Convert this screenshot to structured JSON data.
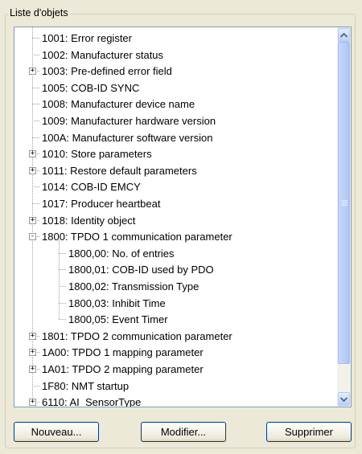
{
  "group_title": "Liste d'objets",
  "tree_items": [
    {
      "label": "1001: Error register",
      "level": 0,
      "expander": ""
    },
    {
      "label": "1002: Manufacturer status",
      "level": 0,
      "expander": ""
    },
    {
      "label": "1003: Pre-defined error field",
      "level": 0,
      "expander": "+"
    },
    {
      "label": "1005: COB-ID SYNC",
      "level": 0,
      "expander": ""
    },
    {
      "label": "1008: Manufacturer device name",
      "level": 0,
      "expander": ""
    },
    {
      "label": "1009: Manufacturer hardware version",
      "level": 0,
      "expander": ""
    },
    {
      "label": "100A: Manufacturer software version",
      "level": 0,
      "expander": ""
    },
    {
      "label": "1010: Store parameters",
      "level": 0,
      "expander": "+"
    },
    {
      "label": "1011: Restore default parameters",
      "level": 0,
      "expander": "+"
    },
    {
      "label": "1014: COB-ID EMCY",
      "level": 0,
      "expander": ""
    },
    {
      "label": "1017: Producer heartbeat",
      "level": 0,
      "expander": ""
    },
    {
      "label": "1018: Identity object",
      "level": 0,
      "expander": "+"
    },
    {
      "label": "1800: TPDO 1 communication parameter",
      "level": 0,
      "expander": "-"
    },
    {
      "label": "1800,00: No. of entries",
      "level": 1,
      "expander": ""
    },
    {
      "label": "1800,01: COB-ID used by PDO",
      "level": 1,
      "expander": ""
    },
    {
      "label": "1800,02: Transmission Type",
      "level": 1,
      "expander": ""
    },
    {
      "label": "1800,03: Inhibit Time",
      "level": 1,
      "expander": ""
    },
    {
      "label": "1800,05: Event Timer",
      "level": 1,
      "expander": ""
    },
    {
      "label": "1801: TPDO 2 communication parameter",
      "level": 0,
      "expander": "+"
    },
    {
      "label": "1A00: TPDO 1 mapping parameter",
      "level": 0,
      "expander": "+"
    },
    {
      "label": "1A01: TPDO 2 mapping parameter",
      "level": 0,
      "expander": "+"
    },
    {
      "label": "1F80: NMT startup",
      "level": 0,
      "expander": ""
    },
    {
      "label": "6110: AI_SensorType",
      "level": 0,
      "expander": "+"
    }
  ],
  "scrollbar": {
    "up_icon": "arrow-up-icon",
    "down_icon": "arrow-down-icon",
    "position_fraction": 0.0,
    "visible_fraction": 0.92
  },
  "buttons": {
    "new_label": "Nouveau...",
    "modify_label": "Modifier...",
    "delete_label": "Supprimer"
  },
  "colors": {
    "window_bg": "#ece9d8",
    "tree_border": "#7f9db9",
    "scroll_thumb": "#b8cdf7",
    "button_border": "#003c74"
  }
}
